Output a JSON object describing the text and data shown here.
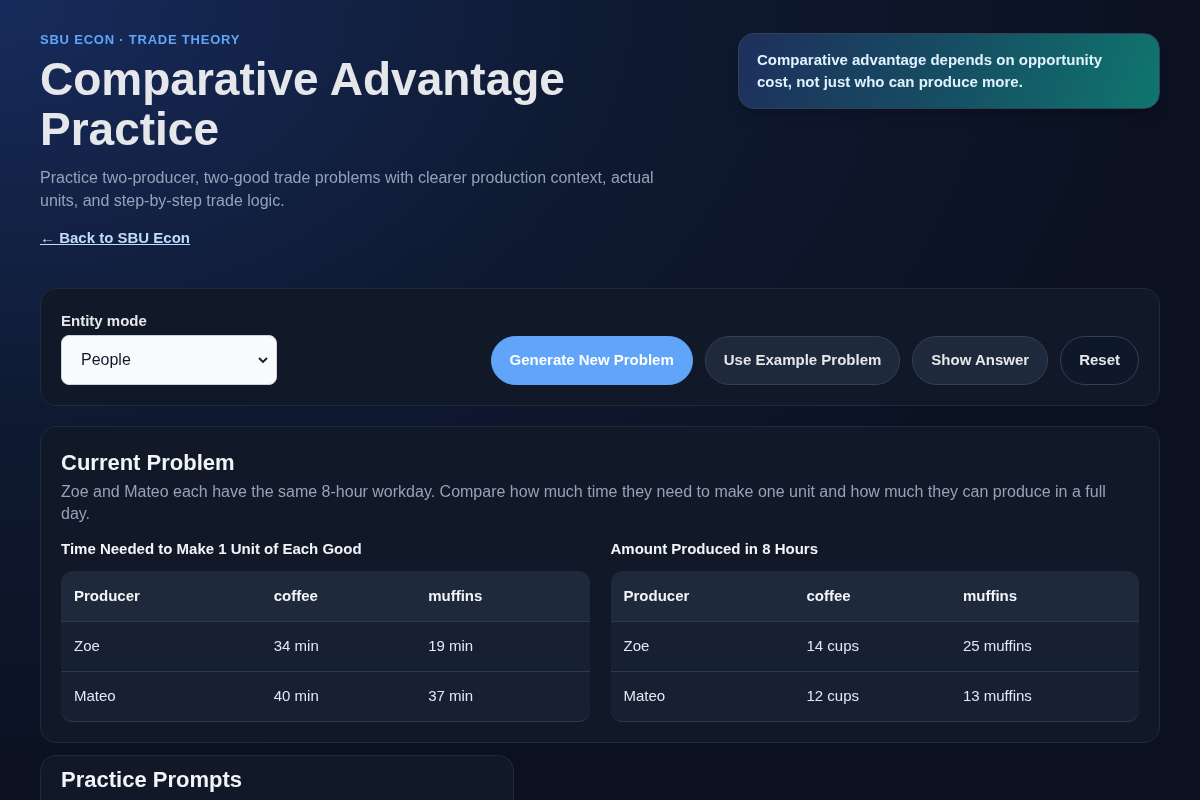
{
  "header": {
    "eyebrow": "SBU ECON · TRADE THEORY",
    "title": "Comparative Advantage Practice",
    "subtitle": "Practice two-producer, two-good trade problems with clearer production context, actual units, and step-by-step trade logic.",
    "back_link": "← Back to SBU Econ"
  },
  "callout": {
    "text": "Comparative advantage depends on opportunity cost, not just who can produce more."
  },
  "controls": {
    "entity_mode": {
      "label": "Entity mode",
      "value": "People"
    },
    "buttons": [
      {
        "label": "Generate New Problem",
        "kind": "primary"
      },
      {
        "label": "Use Example Problem",
        "kind": "secondary"
      },
      {
        "label": "Show Answer",
        "kind": "secondary"
      },
      {
        "label": "Reset",
        "kind": "outline"
      }
    ]
  },
  "current_problem": {
    "title": "Current Problem",
    "description": "Zoe and Mateo each have the same 8-hour workday. Compare how much time they need to make one unit and how much they can produce in a full day.",
    "tables": [
      {
        "title": "Time Needed to Make 1 Unit of Each Good",
        "columns": [
          "Producer",
          "coffee",
          "muffins"
        ],
        "rows": [
          [
            "Zoe",
            "34 min",
            "19 min"
          ],
          [
            "Mateo",
            "40 min",
            "37 min"
          ]
        ]
      },
      {
        "title": "Amount Produced in 8 Hours",
        "columns": [
          "Producer",
          "coffee",
          "muffins"
        ],
        "rows": [
          [
            "Zoe",
            "14 cups",
            "25 muffins"
          ],
          [
            "Mateo",
            "12 cups",
            "13 muffins"
          ]
        ]
      }
    ]
  },
  "practice_prompts": {
    "title": "Practice Prompts"
  }
}
